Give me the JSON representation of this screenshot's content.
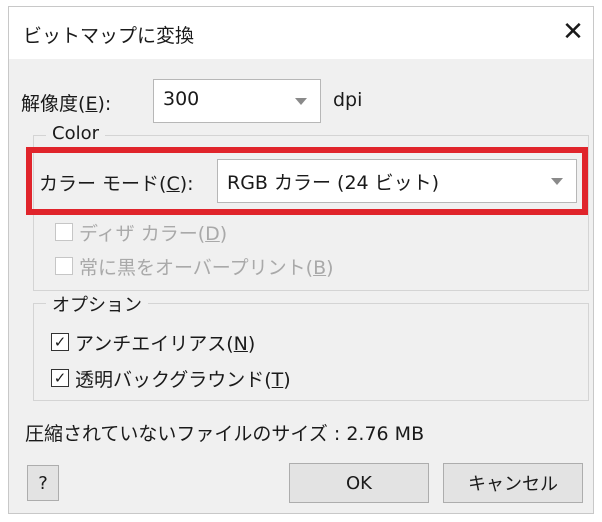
{
  "title": "ビットマップに変換",
  "close_glyph": "✕",
  "resolution": {
    "label": "解像度",
    "mnemonic": "E",
    "value": "300",
    "unit": "dpi"
  },
  "color_group": {
    "legend": "Color",
    "mode_label": "カラー モード",
    "mode_mnemonic": "C",
    "mode_value": "RGB カラー (24 ビット)",
    "dither": {
      "label": "ディザ カラー",
      "mnemonic": "D",
      "checked": false,
      "enabled": false
    },
    "overprint": {
      "label": "常に黒をオーバープリント",
      "mnemonic": "B",
      "checked": false,
      "enabled": false
    }
  },
  "options_group": {
    "legend": "オプション",
    "antialias": {
      "label": "アンチエイリアス",
      "mnemonic": "N",
      "checked": true
    },
    "transparent": {
      "label": "透明バックグラウンド",
      "mnemonic": "T",
      "checked": true
    }
  },
  "size_info": "圧縮されていないファイルのサイズ : 2.76 MB",
  "buttons": {
    "help": "?",
    "ok": "OK",
    "cancel": "キャンセル"
  },
  "highlight_color": "#e0242b",
  "icons": {
    "close": "close-icon",
    "dropdown": "chevron-down-icon",
    "check": "checkmark-icon"
  },
  "check_glyph": "✓"
}
